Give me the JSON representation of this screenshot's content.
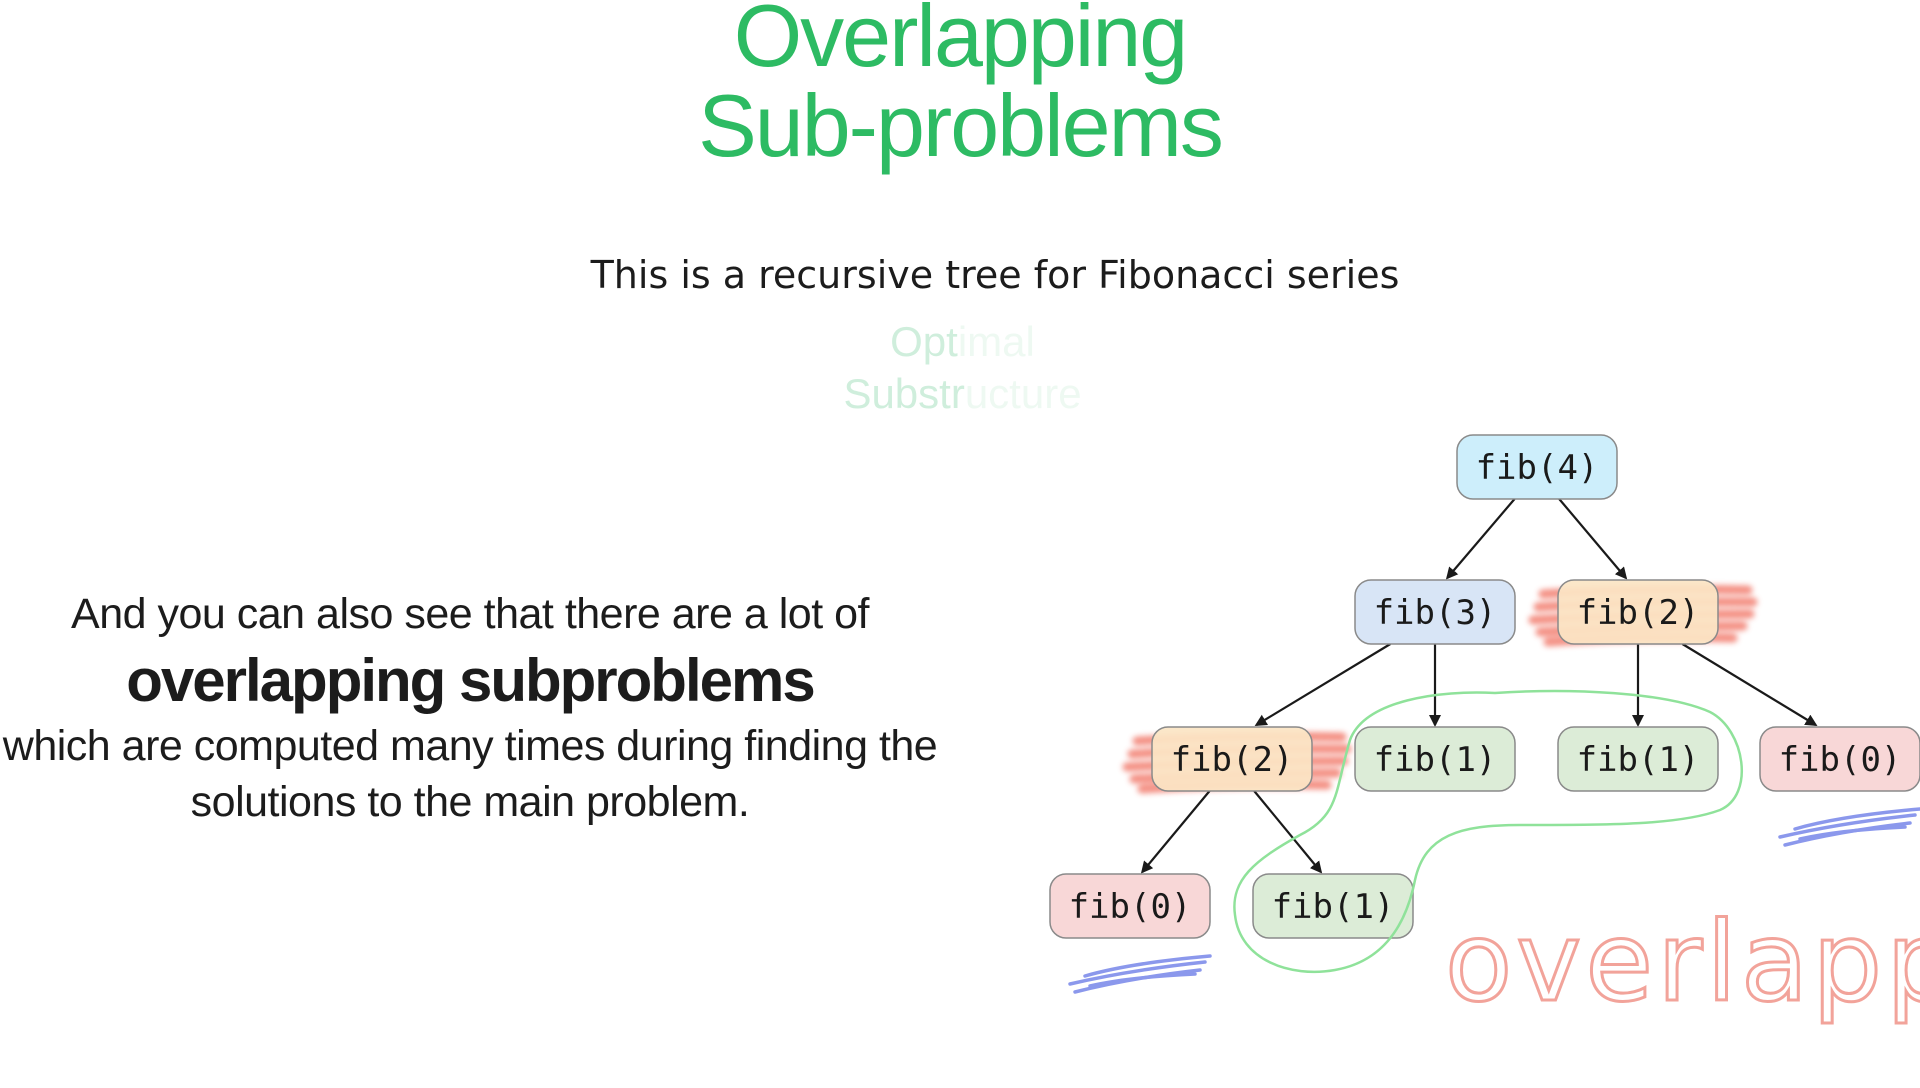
{
  "title": {
    "line1": "Overlapping",
    "line2": "Sub-problems"
  },
  "subtitle": "This is a recursive tree for Fibonacci series",
  "faded_text": {
    "line1_a": "Opt",
    "line1_b": "imal",
    "line2_a": "Substr",
    "line2_b": "ucture"
  },
  "explanation": {
    "line1": "And you can also see that there are a lot of",
    "line2": "overlapping subproblems",
    "line3": "which are computed many times during finding the",
    "line4": "solutions to the main problem."
  },
  "tree": {
    "nodes": [
      {
        "id": "n1",
        "label": "fib(4)",
        "fill": "#c9edfb",
        "highlight": "none"
      },
      {
        "id": "n2",
        "label": "fib(3)",
        "fill": "#d5e3f5",
        "highlight": "none"
      },
      {
        "id": "n3",
        "label": "fib(2)",
        "fill": "#fbe5c4",
        "highlight": "red-scribble"
      },
      {
        "id": "n4",
        "label": "fib(2)",
        "fill": "#fbe5c4",
        "highlight": "red-scribble"
      },
      {
        "id": "n5",
        "label": "fib(1)",
        "fill": "#d9ead4",
        "highlight": "green-outline"
      },
      {
        "id": "n6",
        "label": "fib(1)",
        "fill": "#d9ead4",
        "highlight": "green-outline"
      },
      {
        "id": "n7",
        "label": "fib(0)",
        "fill": "#f7d4d4",
        "highlight": "blue-scribble"
      },
      {
        "id": "n8",
        "label": "fib(0)",
        "fill": "#f7d4d4",
        "highlight": "blue-scribble"
      },
      {
        "id": "n9",
        "label": "fib(1)",
        "fill": "#d9ead4",
        "highlight": "green-outline"
      }
    ],
    "edges": [
      [
        "n1",
        "n2"
      ],
      [
        "n1",
        "n3"
      ],
      [
        "n2",
        "n4"
      ],
      [
        "n2",
        "n5"
      ],
      [
        "n3",
        "n6"
      ],
      [
        "n3",
        "n7"
      ],
      [
        "n4",
        "n8"
      ],
      [
        "n4",
        "n9"
      ]
    ],
    "annotation": "overlapping",
    "colors": {
      "edge": "#1a1a1a",
      "node_border": "#8a8a8a",
      "scribble_red": "#f06a5a",
      "scribble_blue": "#6f7fe8",
      "outline_green": "#8fe29a",
      "annotation": "#f2a39a"
    }
  },
  "colors": {
    "title": "#2dbb63",
    "text": "#1c1c1c"
  }
}
